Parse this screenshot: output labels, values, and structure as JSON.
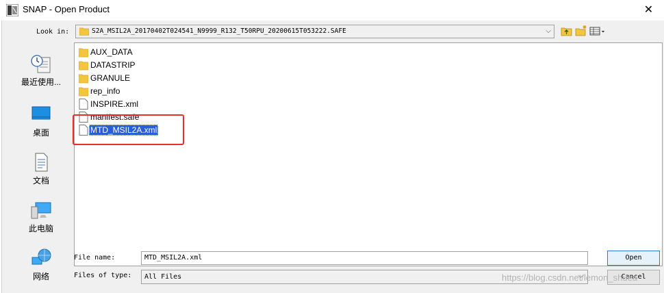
{
  "window": {
    "title": "SNAP - Open Product",
    "close_label": "✕"
  },
  "look_in": {
    "label": "Look in:",
    "value": "S2A_MSIL2A_20170402T024541_N9999_R132_T50RPU_20200615T053222.SAFE",
    "toolbar_icons": [
      "up-folder-icon",
      "new-folder-icon",
      "view-menu-icon"
    ]
  },
  "places": [
    {
      "label": "最近使用...",
      "icon": "recent-icon"
    },
    {
      "label": "桌面",
      "icon": "desktop-icon"
    },
    {
      "label": "文档",
      "icon": "documents-icon"
    },
    {
      "label": "此电脑",
      "icon": "computer-icon"
    },
    {
      "label": "网络",
      "icon": "network-icon"
    }
  ],
  "files": [
    {
      "name": "AUX_DATA",
      "type": "folder"
    },
    {
      "name": "DATASTRIP",
      "type": "folder"
    },
    {
      "name": "GRANULE",
      "type": "folder"
    },
    {
      "name": "rep_info",
      "type": "folder"
    },
    {
      "name": "INSPIRE.xml",
      "type": "file"
    },
    {
      "name": "manifest.safe",
      "type": "file"
    },
    {
      "name": "MTD_MSIL2A.xml",
      "type": "file",
      "selected": true
    }
  ],
  "file_name": {
    "label": "File name:",
    "value": "MTD_MSIL2A.xml"
  },
  "files_of_type": {
    "label": "Files of type:",
    "value": "All Files"
  },
  "buttons": {
    "open": "Open",
    "cancel": "Cancel"
  },
  "watermark": "https://blog.csdn.net/lemon_shuea",
  "colors": {
    "selection": "#2860d8",
    "highlight_box": "#e03030",
    "folder": "#f5c542"
  }
}
